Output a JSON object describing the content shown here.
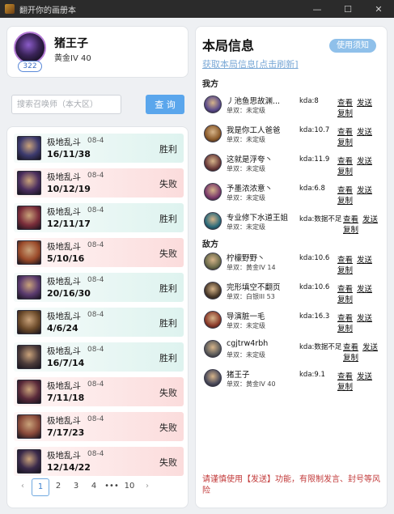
{
  "window": {
    "title": "翻开你的画册本",
    "controls": [
      "—",
      "☐",
      "✕"
    ]
  },
  "profile": {
    "name": "猪王子",
    "rank": "黄金IV 40",
    "level": "322"
  },
  "search": {
    "placeholder": "搜索召唤师（本大区）",
    "button_label": "查 询"
  },
  "matches": [
    {
      "mode": "极地乱斗",
      "date": "08-4",
      "kda": "16/11/38",
      "result": "胜利",
      "outcome": "win",
      "champ_color": "#3c3a6e"
    },
    {
      "mode": "极地乱斗",
      "date": "08-4",
      "kda": "10/12/19",
      "result": "失败",
      "outcome": "loss",
      "champ_color": "#4b2e5e"
    },
    {
      "mode": "极地乱斗",
      "date": "08-4",
      "kda": "12/11/17",
      "result": "胜利",
      "outcome": "win",
      "champ_color": "#7a2d3a"
    },
    {
      "mode": "极地乱斗",
      "date": "08-4",
      "kda": "5/10/16",
      "result": "失败",
      "outcome": "loss",
      "champ_color": "#9a4a2a"
    },
    {
      "mode": "极地乱斗",
      "date": "08-4",
      "kda": "20/16/30",
      "result": "胜利",
      "outcome": "win",
      "champ_color": "#5a3a6e"
    },
    {
      "mode": "极地乱斗",
      "date": "08-4",
      "kda": "4/6/24",
      "result": "胜利",
      "outcome": "win",
      "champ_color": "#6b4a2a"
    },
    {
      "mode": "极地乱斗",
      "date": "08-4",
      "kda": "16/7/14",
      "result": "胜利",
      "outcome": "win",
      "champ_color": "#4a3a3a"
    },
    {
      "mode": "极地乱斗",
      "date": "08-4",
      "kda": "7/11/18",
      "result": "失败",
      "outcome": "loss",
      "champ_color": "#5a2a3a"
    },
    {
      "mode": "极地乱斗",
      "date": "08-4",
      "kda": "7/17/23",
      "result": "失败",
      "outcome": "loss",
      "champ_color": "#8a4a3a"
    },
    {
      "mode": "极地乱斗",
      "date": "08-4",
      "kda": "12/14/22",
      "result": "失败",
      "outcome": "loss",
      "champ_color": "#3a2a4a"
    }
  ],
  "pagination": {
    "prev": "‹",
    "pages": [
      "1",
      "2",
      "3",
      "4",
      "•••",
      "10"
    ],
    "active": "1",
    "next": "›"
  },
  "game_info": {
    "title": "本局信息",
    "notice_button": "使用须知",
    "fetch_link": "获取本局信息[点击刷新]",
    "ally_label": "我方",
    "enemy_label": "敌方",
    "view_label": "查看",
    "send_label": "发送",
    "copy_label": "复制",
    "allies": [
      {
        "name": "丿池鱼思故渊...",
        "rank": "单双：未定级",
        "kda": "kda:8",
        "avatar_color": "#5a4a8a"
      },
      {
        "name": "我是你工人爸爸",
        "rank": "单双：未定级",
        "kda": "kda:10.7",
        "avatar_color": "#8a5a2a"
      },
      {
        "name": "这就是浮夸丶",
        "rank": "单双：未定级",
        "kda": "kda:11.9",
        "avatar_color": "#6a3a3a"
      },
      {
        "name": "予墨浓浓意丶",
        "rank": "单双：未定级",
        "kda": "kda:6.8",
        "avatar_color": "#7a3a6a"
      },
      {
        "name": "专业修下水道王姐",
        "rank": "单双：未定级",
        "kda": "kda:数据不足",
        "avatar_color": "#2a6a7a"
      }
    ],
    "enemies": [
      {
        "name": "柠檬野野丶",
        "rank": "单双：黄金IV 14",
        "kda": "kda:10.6",
        "avatar_color": "#6a6a4a"
      },
      {
        "name": "完形填空不翻页",
        "rank": "单双：白银III 53",
        "kda": "kda:10.6",
        "avatar_color": "#4a3a2a"
      },
      {
        "name": "导演脏一毛",
        "rank": "单双：未定级",
        "kda": "kda:16.3",
        "avatar_color": "#8a3a2a"
      },
      {
        "name": "cgjtrw4rbh",
        "rank": "单双：未定级",
        "kda": "kda:数据不足",
        "avatar_color": "#5a5a5a"
      },
      {
        "name": "猪王子",
        "rank": "单双：黄金IV 40",
        "kda": "kda:9.1",
        "avatar_color": "#4a4a5a"
      }
    ],
    "warning": "请谨慎使用【发送】功能，有限制发言、封号等风险"
  }
}
